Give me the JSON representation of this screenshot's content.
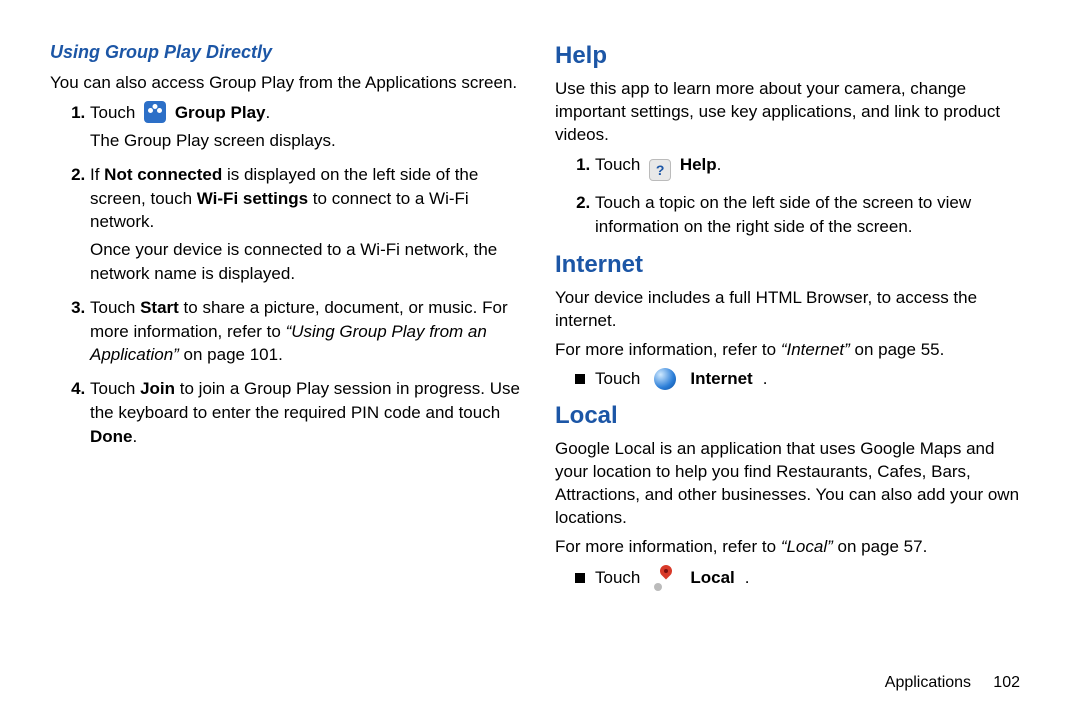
{
  "left": {
    "subhead": "Using Group Play Directly",
    "intro": "You can also access Group Play from the Applications screen.",
    "s1_a": "Touch ",
    "s1_b": "Group Play",
    "s1_c": ".",
    "s1_sub": "The Group Play screen displays.",
    "s2_a": "If ",
    "s2_b": "Not connected",
    "s2_c": " is displayed on the left side of the screen, touch ",
    "s2_d": "Wi-Fi settings",
    "s2_e": " to connect to a Wi-Fi network.",
    "s2_sub": "Once your device is connected to a Wi-Fi network, the network name is displayed.",
    "s3_a": "Touch ",
    "s3_b": "Start",
    "s3_c": " to share a picture, document, or music. For more information, refer to ",
    "s3_d": "“Using Group Play from an Application”",
    "s3_e": " on page 101.",
    "s4_a": "Touch ",
    "s4_b": "Join",
    "s4_c": " to join a Group Play session in progress. Use the keyboard to enter the required PIN code and touch ",
    "s4_d": "Done",
    "s4_e": "."
  },
  "right": {
    "help_title": "Help",
    "help_intro": "Use this app to learn more about your camera, change important settings, use key applications, and link to product videos.",
    "help_s1_a": "Touch ",
    "help_s1_b": "Help",
    "help_s1_c": ".",
    "help_s2": "Touch a topic on the left side of the screen to view information on the right side of the screen.",
    "internet_title": "Internet",
    "internet_intro": "Your device includes a full HTML Browser, to access the internet.",
    "internet_more_a": "For more information, refer to ",
    "internet_more_b": "“Internet”",
    "internet_more_c": " on page 55.",
    "internet_b_a": "Touch ",
    "internet_b_b": "Internet",
    "internet_b_c": ".",
    "local_title": "Local",
    "local_intro": "Google Local is an application that uses Google Maps and your location to help you find Restaurants, Cafes, Bars, Attractions, and other businesses. You can also add your own locations.",
    "local_more_a": "For more information, refer to ",
    "local_more_b": "“Local”",
    "local_more_c": " on page 57.",
    "local_b_a": "Touch ",
    "local_b_b": "Local",
    "local_b_c": "."
  },
  "footer": {
    "section": "Applications",
    "page": "102"
  },
  "icons": {
    "help_glyph": "?"
  }
}
